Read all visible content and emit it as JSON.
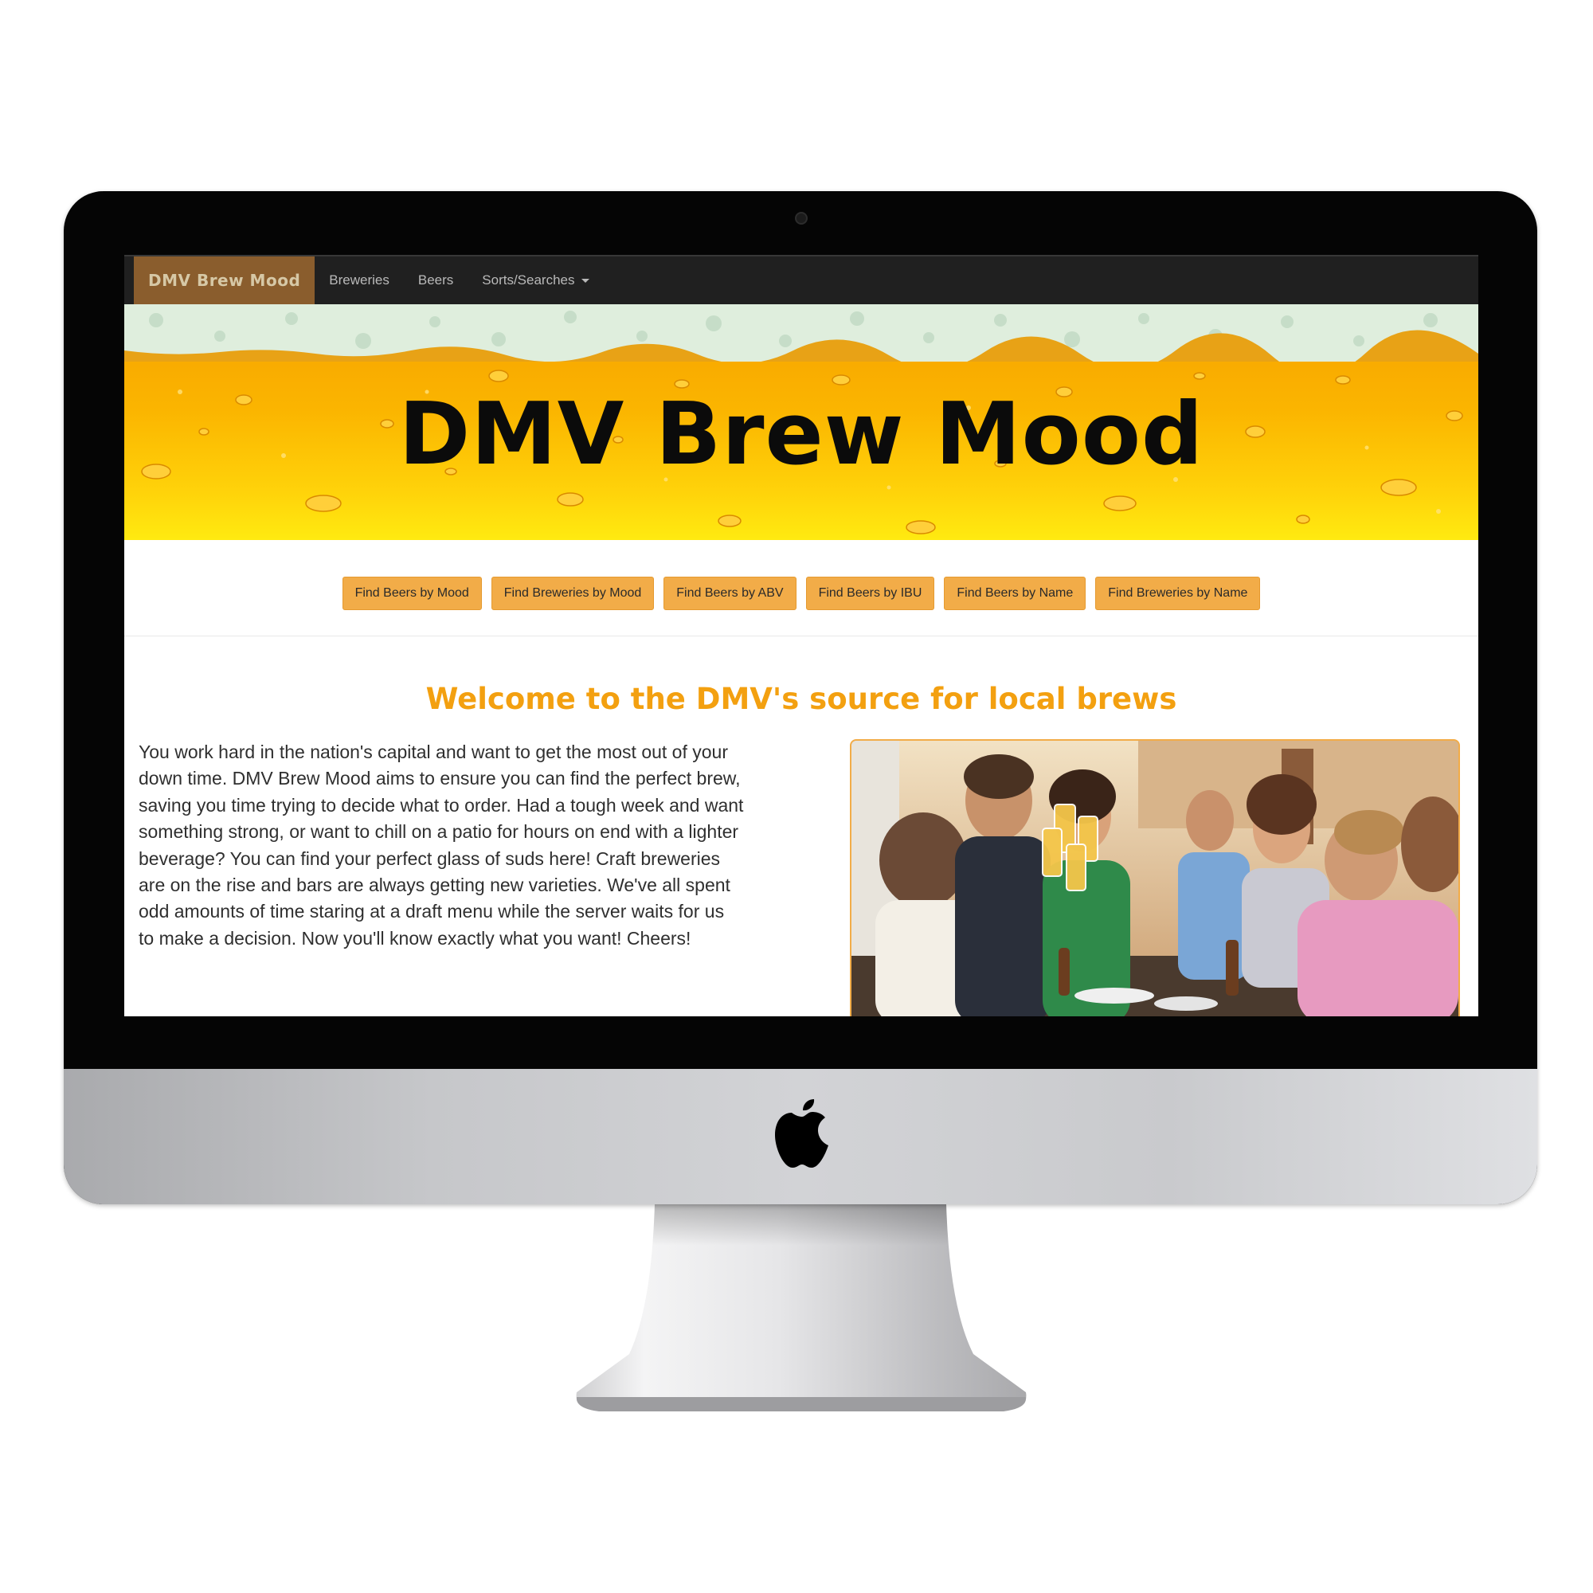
{
  "navbar": {
    "brand": "DMV Brew Mood",
    "links": [
      "Breweries",
      "Beers",
      "Sorts/Searches"
    ]
  },
  "hero": {
    "title": "DMV Brew Mood"
  },
  "buttons": [
    "Find Beers by Mood",
    "Find Breweries by Mood",
    "Find Beers by ABV",
    "Find Beers by IBU",
    "Find Beers by Name",
    "Find Breweries by Name"
  ],
  "welcome": {
    "heading": "Welcome to the DMV's source for local brews",
    "body": "You work hard in the nation's capital and want to get the most out of your down time. DMV Brew Mood aims to ensure you can find the perfect brew, saving you time trying to decide what to order. Had a tough week and want something strong, or want to chill on a patio for hours on end with a lighter beverage? You can find your perfect glass of suds here! Craft breweries are on the rise and bars are always getting new varieties. We've all spent odd amounts of time staring at a draft menu while the server waits for us to make a decision. Now you'll know exactly what you want! Cheers!"
  },
  "colors": {
    "accent": "#f2ac48",
    "heading": "#f3a010",
    "navbar": "#202020",
    "brand_bg": "#8a5d2d"
  },
  "icons": {
    "dropdown": "caret-down-icon",
    "device_logo": "apple-icon"
  }
}
